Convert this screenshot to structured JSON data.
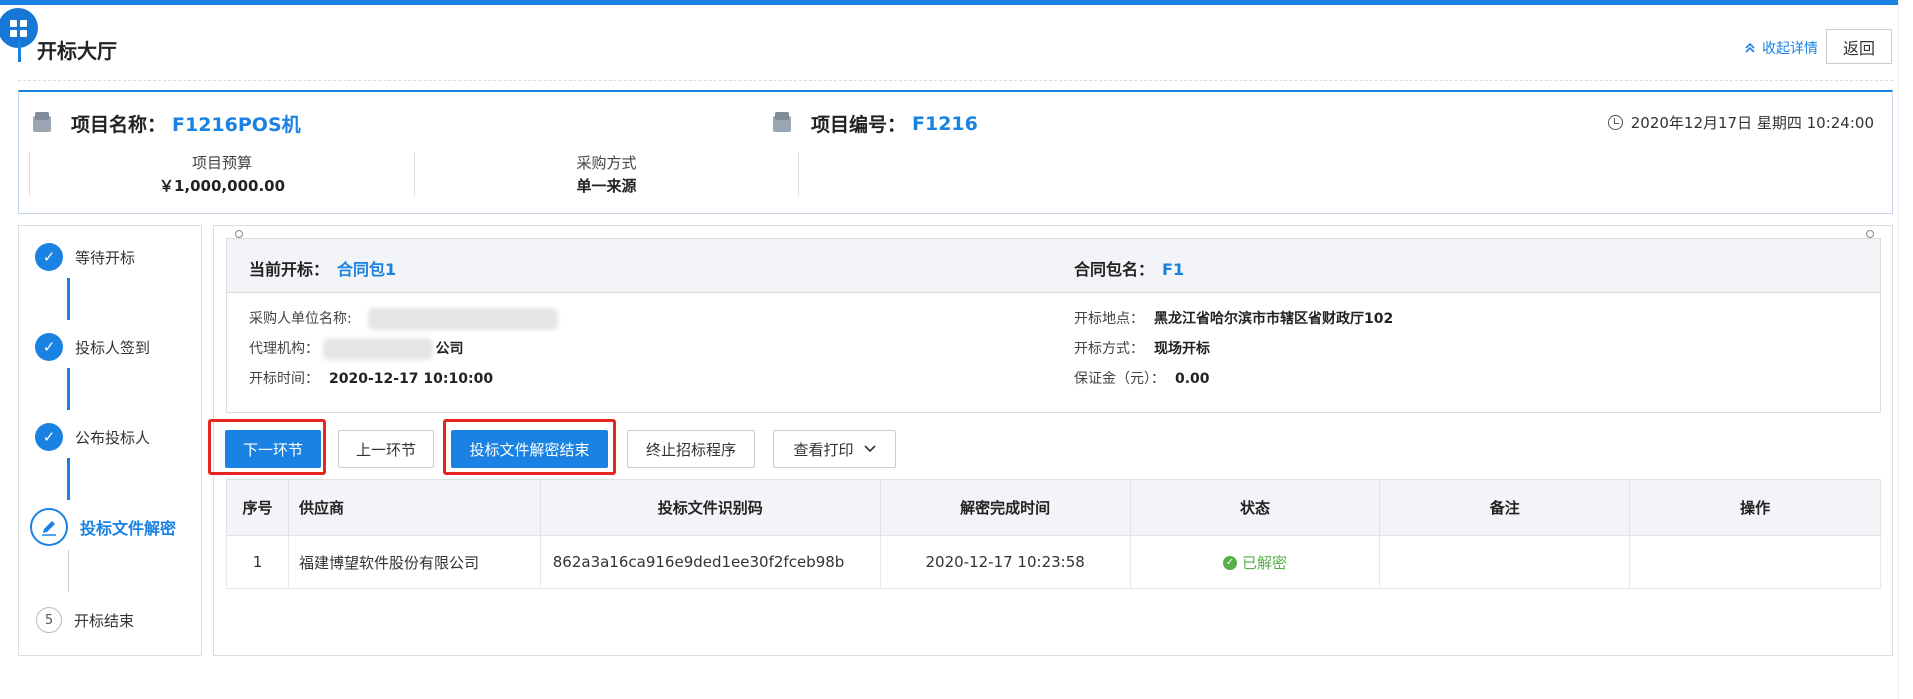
{
  "header": {
    "title": "开标大厅",
    "collapse_label": "收起详情",
    "back_label": "返回"
  },
  "project": {
    "name_label": "项目名称：",
    "name_value": "F1216POS机",
    "code_label": "项目编号：",
    "code_value": "F1216",
    "datetime": "2020年12月17日 星期四 10:24:00",
    "budget_label": "项目预算",
    "budget_value": "￥1,000,000.00",
    "method_label": "采购方式",
    "method_value": "单一来源"
  },
  "steps": [
    {
      "label": "等待开标",
      "state": "done"
    },
    {
      "label": "投标人签到",
      "state": "done"
    },
    {
      "label": "公布投标人",
      "state": "done"
    },
    {
      "label": "投标文件解密",
      "state": "current"
    },
    {
      "label": "开标结束",
      "state": "pending",
      "number": "5"
    }
  ],
  "bid": {
    "current_label": "当前开标：",
    "current_value": "合同包1",
    "package_label": "合同包名：",
    "package_value": "F1",
    "purchaser_label": "采购人单位名称:",
    "agency_label": "代理机构：",
    "agency_suffix": "公司",
    "open_time_label": "开标时间：",
    "open_time_value": "2020-12-17 10:10:00",
    "location_label": "开标地点：",
    "location_value": "黑龙江省哈尔滨市市辖区省财政厅102",
    "mode_label": "开标方式：",
    "mode_value": "现场开标",
    "deposit_label": "保证金（元）：",
    "deposit_value": "0.00"
  },
  "actions": {
    "next": "下一环节",
    "prev": "上一环节",
    "decrypt_end": "投标文件解密结束",
    "terminate": "终止招标程序",
    "print": "查看打印"
  },
  "table": {
    "columns": [
      "序号",
      "供应商",
      "投标文件识别码",
      "解密完成时间",
      "状态",
      "备注",
      "操作"
    ],
    "rows": [
      {
        "no": "1",
        "supplier": "福建博望软件股份有限公司",
        "code": "862a3a16ca916e9ded1ee30f2fceb98b",
        "time": "2020-12-17 10:23:58",
        "status": "已解密",
        "remark": "",
        "op": ""
      }
    ]
  },
  "colors": {
    "accent": "#1a82e2",
    "highlight": "#e8261f",
    "success": "#52b045"
  }
}
